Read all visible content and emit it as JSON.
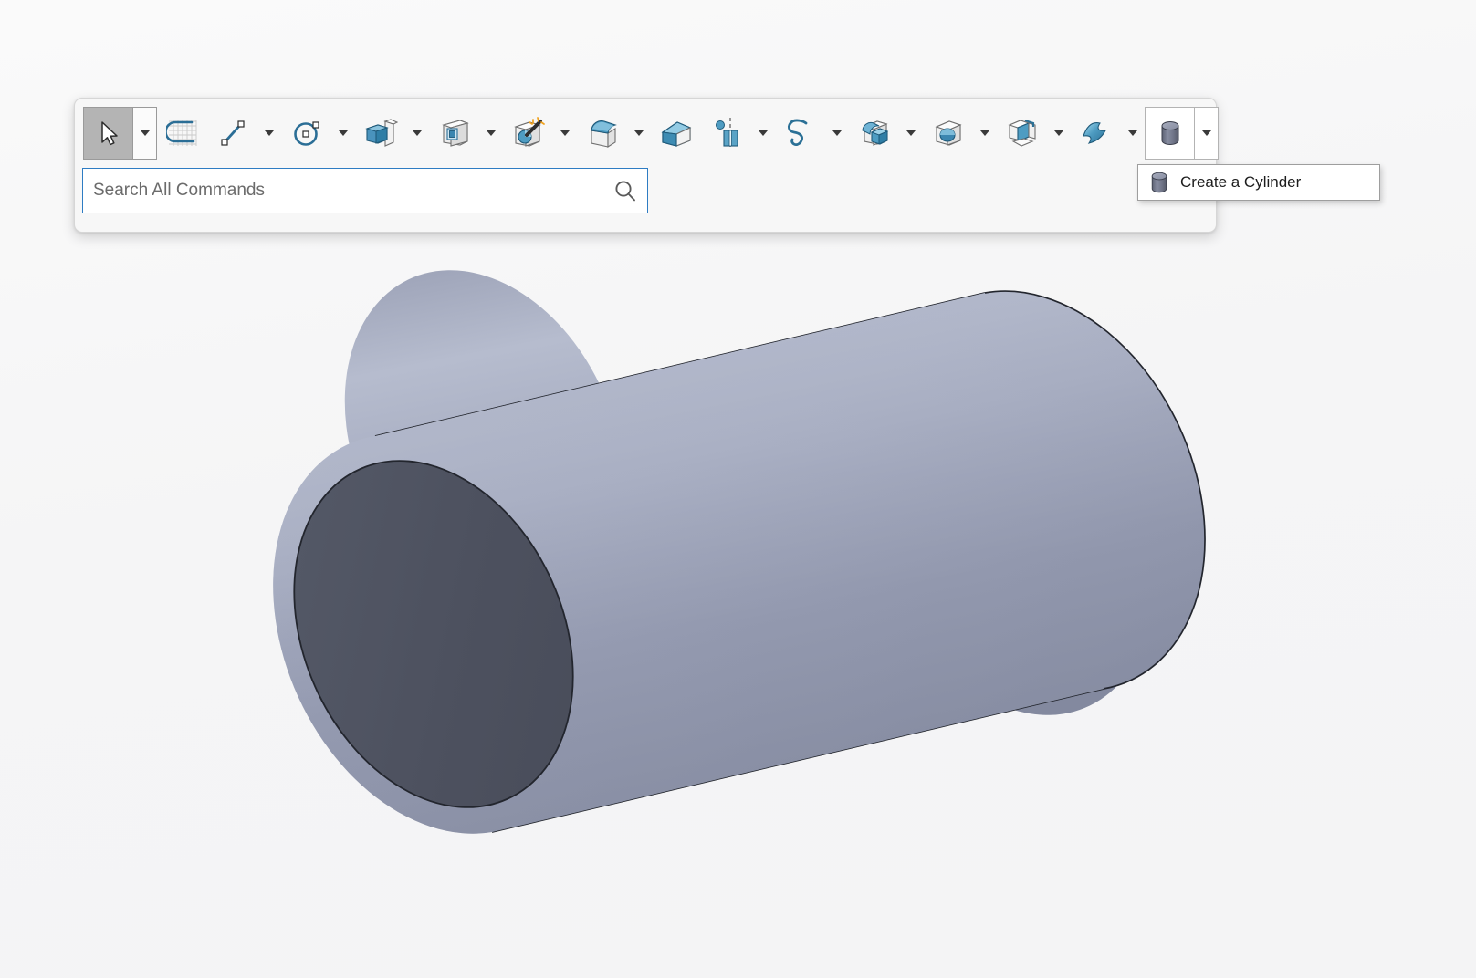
{
  "app": {
    "background_color": "#f5f5f6",
    "panel_color": "#f7f7f7",
    "accent_color": "#2e7cc3",
    "icon_blue": "#4a90b8",
    "icon_gray": "#e8e8e8"
  },
  "toolbar": {
    "name": "Modeling Toolbar",
    "items": [
      {
        "id": "select",
        "icon": "cursor-arrow-icon",
        "label": "Select",
        "has_caret": true,
        "state": "active"
      },
      {
        "id": "sketch",
        "icon": "sketch-grid-icon",
        "label": "Sketch",
        "has_caret": false,
        "state": "normal"
      },
      {
        "id": "line",
        "icon": "line-icon",
        "label": "Line",
        "has_caret": true,
        "state": "normal"
      },
      {
        "id": "circle",
        "icon": "circle-icon",
        "label": "Circle",
        "has_caret": true,
        "state": "normal"
      },
      {
        "id": "extrude",
        "icon": "extrude-icon",
        "label": "Extrude",
        "has_caret": true,
        "state": "normal"
      },
      {
        "id": "thicken",
        "icon": "thicken-shell-icon",
        "label": "Thicken",
        "has_caret": true,
        "state": "normal"
      },
      {
        "id": "magic-select",
        "icon": "magic-wand-icon",
        "label": "Magic Select",
        "has_caret": true,
        "state": "normal"
      },
      {
        "id": "fillet",
        "icon": "fillet-edge-icon",
        "label": "Fillet",
        "has_caret": true,
        "state": "normal"
      },
      {
        "id": "chamfer",
        "icon": "chamfer-icon",
        "label": "Chamfer",
        "has_caret": false,
        "state": "normal"
      },
      {
        "id": "mirror",
        "icon": "mirror-plane-icon",
        "label": "Mirror",
        "has_caret": true,
        "state": "normal"
      },
      {
        "id": "spline",
        "icon": "spline-curve-icon",
        "label": "Spline",
        "has_caret": true,
        "state": "normal"
      },
      {
        "id": "boolean-union",
        "icon": "boolean-union-icon",
        "label": "Boolean",
        "has_caret": true,
        "state": "normal"
      },
      {
        "id": "hole",
        "icon": "hole-cube-icon",
        "label": "Hole",
        "has_caret": true,
        "state": "normal"
      },
      {
        "id": "shell",
        "icon": "shell-unfold-icon",
        "label": "Shell",
        "has_caret": true,
        "state": "normal"
      },
      {
        "id": "freeform",
        "icon": "freeform-surface-icon",
        "label": "Freeform Surface",
        "has_caret": true,
        "state": "normal"
      },
      {
        "id": "primitive",
        "icon": "cylinder-icon",
        "label": "Create a Cylinder",
        "has_caret": true,
        "state": "hover-open"
      }
    ]
  },
  "search": {
    "placeholder": "Search All Commands",
    "value": "",
    "icon": "search-magnifier-icon"
  },
  "tooltip": {
    "visible": true,
    "icon": "cylinder-icon",
    "label": "Create a Cylinder"
  },
  "viewport": {
    "name": "3d-viewport",
    "model": "cylinder",
    "body_color_light": "#aab0c4",
    "body_color_mid": "#8b91a8",
    "cap_color": "#4e525f",
    "edge_color": "#23262e"
  }
}
